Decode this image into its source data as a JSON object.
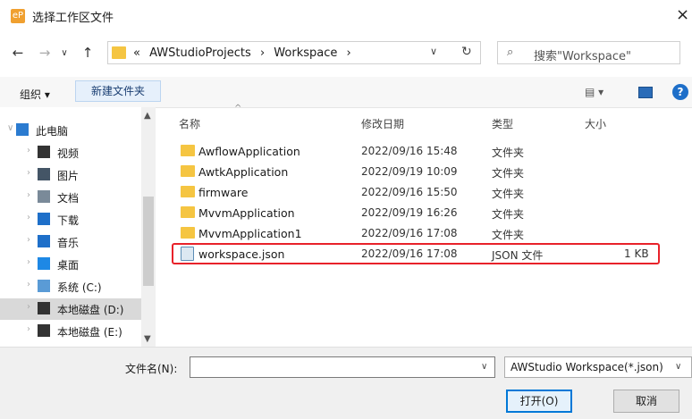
{
  "window": {
    "title": "选择工作区文件",
    "app_icon": "eP",
    "close": "×"
  },
  "nav": {
    "back": "←",
    "forward": "→",
    "recent": "∨",
    "up": "↑"
  },
  "address": {
    "prefix": "«",
    "crumbs": [
      "AWStudioProjects",
      "›",
      "Workspace",
      "›"
    ],
    "dropdown": "∨",
    "refresh": "↻"
  },
  "search": {
    "icon": "⌕",
    "placeholder": "搜索\"Workspace\""
  },
  "toolbar": {
    "organize_label": "组织 ▾",
    "new_folder_label": "新建文件夹",
    "view_label": "▤ ▾",
    "help": "?"
  },
  "sidebar": {
    "items": [
      {
        "label": "此电脑",
        "icon": "computer-icon",
        "color": "#2b7bd0",
        "expand": "∨"
      },
      {
        "label": "视频",
        "icon": "video-icon",
        "color": "#333333",
        "expand": "›"
      },
      {
        "label": "图片",
        "icon": "picture-icon",
        "color": "#445566",
        "expand": "›"
      },
      {
        "label": "文档",
        "icon": "document-icon",
        "color": "#7a8a99",
        "expand": "›"
      },
      {
        "label": "下载",
        "icon": "download-icon",
        "color": "#1e6fc9",
        "expand": "›"
      },
      {
        "label": "音乐",
        "icon": "music-icon",
        "color": "#1e6fc9",
        "expand": "›"
      },
      {
        "label": "桌面",
        "icon": "desktop-icon",
        "color": "#1e88e5",
        "expand": "›"
      },
      {
        "label": "系统 (C:)",
        "icon": "system-drive-icon",
        "color": "#5a9bd6",
        "expand": "›"
      },
      {
        "label": "本地磁盘 (D:)",
        "icon": "drive-icon",
        "color": "#333333",
        "expand": "›"
      },
      {
        "label": "本地磁盘 (E:)",
        "icon": "drive-icon",
        "color": "#333333",
        "expand": "›"
      }
    ],
    "selected_index": 8
  },
  "columns": {
    "name": "名称",
    "date": "修改日期",
    "type": "类型",
    "size": "大小"
  },
  "files": [
    {
      "name": "AwflowApplication",
      "date": "2022/09/16 15:48",
      "type": "文件夹",
      "size": "",
      "kind": "folder"
    },
    {
      "name": "AwtkApplication",
      "date": "2022/09/19 10:09",
      "type": "文件夹",
      "size": "",
      "kind": "folder"
    },
    {
      "name": "firmware",
      "date": "2022/09/16 15:50",
      "type": "文件夹",
      "size": "",
      "kind": "folder"
    },
    {
      "name": "MvvmApplication",
      "date": "2022/09/19 16:26",
      "type": "文件夹",
      "size": "",
      "kind": "folder"
    },
    {
      "name": "MvvmApplication1",
      "date": "2022/09/16 17:08",
      "type": "文件夹",
      "size": "",
      "kind": "folder"
    },
    {
      "name": "workspace.json",
      "date": "2022/09/16 17:08",
      "type": "JSON 文件",
      "size": "1 KB",
      "kind": "json"
    }
  ],
  "bottom": {
    "filename_label": "文件名(N):",
    "filename_value": "",
    "filter_label": "AWStudio Workspace(*.json)",
    "open_label": "打开(O)",
    "cancel_label": "取消"
  },
  "colors": {
    "highlight": "#e8222a",
    "accent": "#0078d7",
    "folder": "#f5c542"
  }
}
